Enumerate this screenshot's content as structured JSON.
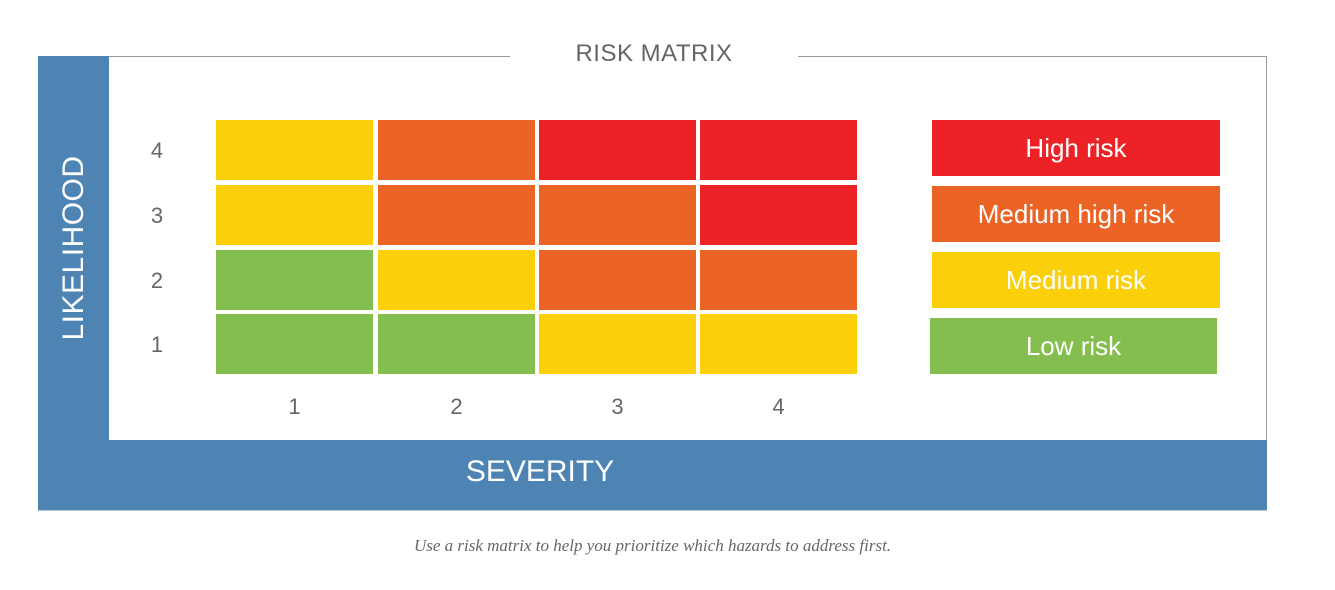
{
  "chart_data": {
    "type": "heatmap",
    "title": "RISK MATRIX",
    "xlabel": "SEVERITY",
    "ylabel": "LIKELIHOOD",
    "x_categories": [
      "1",
      "2",
      "3",
      "4"
    ],
    "y_categories": [
      "4",
      "3",
      "2",
      "1"
    ],
    "values": [
      [
        "medium",
        "medium_high",
        "high",
        "high"
      ],
      [
        "medium",
        "medium_high",
        "medium_high",
        "high"
      ],
      [
        "low",
        "medium",
        "medium_high",
        "medium_high"
      ],
      [
        "low",
        "low",
        "medium",
        "medium"
      ]
    ],
    "legend": [
      {
        "key": "high",
        "label": "High risk",
        "color": "#ec2227"
      },
      {
        "key": "medium_high",
        "label": "Medium high risk",
        "color": "#eb6426"
      },
      {
        "key": "medium",
        "label": "Medium risk",
        "color": "#fbcf0a"
      },
      {
        "key": "low",
        "label": "Low risk",
        "color": "#84be4e"
      }
    ],
    "legend_position": "right",
    "grid": false
  },
  "caption": "Use a risk matrix to help you prioritize which hazards to address first.",
  "colors": {
    "axis_band": "#4e84b3"
  }
}
